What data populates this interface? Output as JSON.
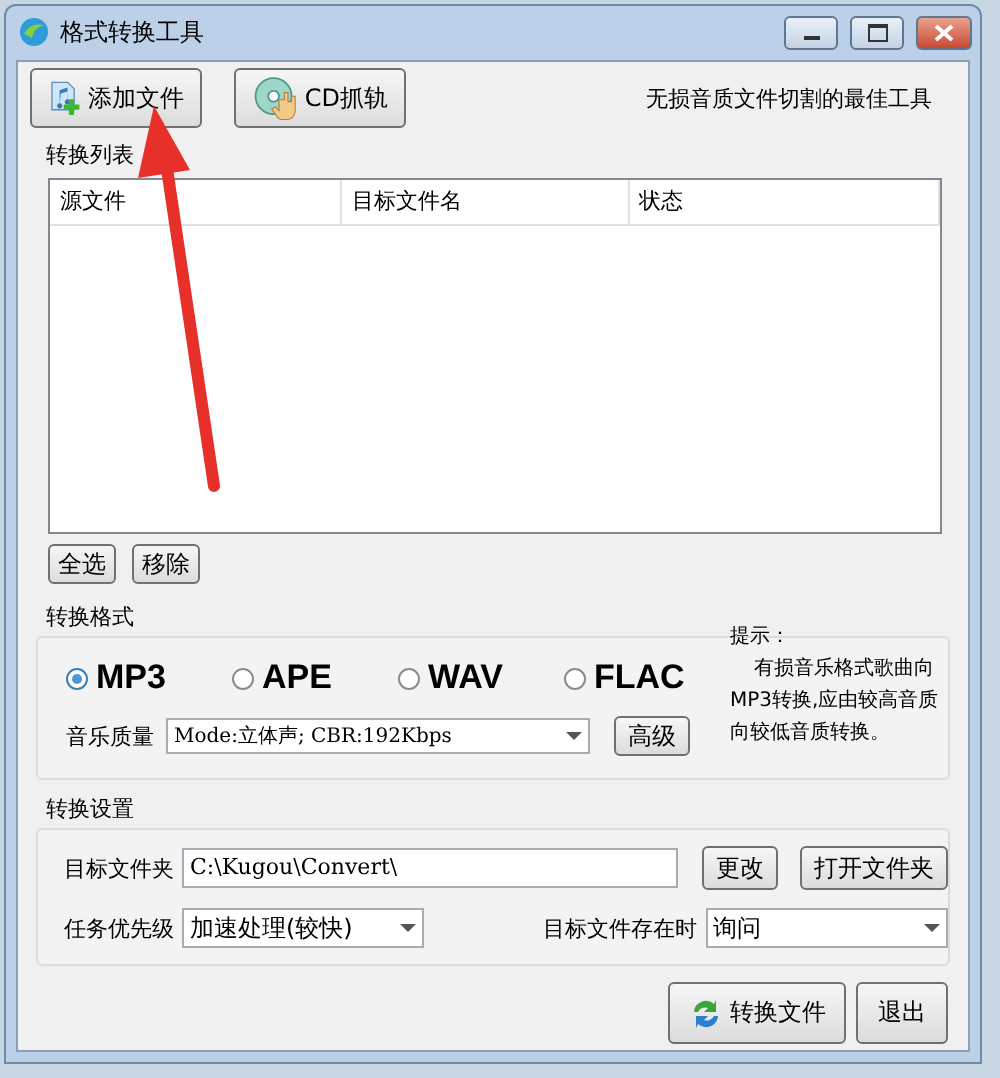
{
  "window": {
    "title": "格式转换工具"
  },
  "toolbar": {
    "buttons": [
      {
        "label": "添加文件",
        "kind": "add-file"
      },
      {
        "label": "CD抓轨",
        "kind": "cd"
      }
    ],
    "slogan": "无损音质文件切割的最佳工具"
  },
  "conversion_list": {
    "title": "转换列表",
    "columns": [
      "源文件",
      "目标文件名",
      "状态"
    ],
    "buttons": [
      "全选",
      "移除"
    ]
  },
  "format": {
    "title": "转换格式",
    "options": [
      {
        "label": "MP3",
        "selected": true
      },
      {
        "label": "APE",
        "selected": false
      },
      {
        "label": "WAV",
        "selected": false
      },
      {
        "label": "FLAC",
        "selected": false
      }
    ],
    "quality_label": "音乐质量",
    "quality_value": "Mode:立体声; CBR:192Kbps",
    "advanced_button": "高级",
    "hint": {
      "title": "提示：",
      "text": "有损音乐格式歌曲向MP3转换,应由较高音质向较低音质转换。"
    }
  },
  "settings": {
    "title": "转换设置",
    "folder_label": "目标文件夹",
    "folder_value": "C:\\Kugou\\Convert\\",
    "folder_buttons": [
      "更改",
      "打开文件夹"
    ],
    "priority_label": "任务优先级",
    "priority_value": "加速处理(较快)",
    "exists_label": "目标文件存在时",
    "exists_value": "询问"
  },
  "actions": [
    {
      "label": "转换文件",
      "kind": "convert"
    },
    {
      "label": "退出",
      "kind": "plain"
    }
  ]
}
